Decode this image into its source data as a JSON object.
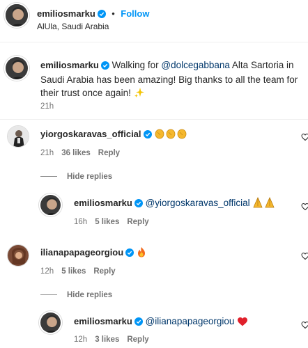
{
  "header": {
    "username": "emiliosmarku",
    "separator": "•",
    "follow_label": "Follow",
    "location": "AlUla, Saudi Arabia"
  },
  "caption": {
    "username": "emiliosmarku",
    "text_before": "Walking for ",
    "mention": "@dolcegabbana",
    "text_after": " Alta Sartoria in Saudi Arabia has been amazing! Big thanks to all the team for their trust once again!",
    "emoji": "sparkles",
    "time": "21h"
  },
  "comments": [
    {
      "username": "yiorgoskaravas_official",
      "emoji": "clapping hands x3",
      "time": "21h",
      "likes": "36 likes",
      "reply_label": "Reply",
      "hide_replies_label": "Hide replies",
      "reply": {
        "username": "emiliosmarku",
        "mention": "@yiorgoskaravas_official",
        "emoji": "folded hands x2",
        "time": "16h",
        "likes": "5 likes",
        "reply_label": "Reply"
      }
    },
    {
      "username": "ilianapapageorgiou",
      "emoji": "fire",
      "time": "12h",
      "likes": "5 likes",
      "reply_label": "Reply",
      "hide_replies_label": "Hide replies",
      "reply": {
        "username": "emiliosmarku",
        "mention": "@ilianapapageorgiou",
        "emoji": "red heart",
        "time": "12h",
        "likes": "3 likes",
        "reply_label": "Reply"
      }
    }
  ],
  "colors": {
    "link": "#0095f6",
    "mention": "#00376b",
    "verified": "#0095f6",
    "muted": "#737373"
  }
}
